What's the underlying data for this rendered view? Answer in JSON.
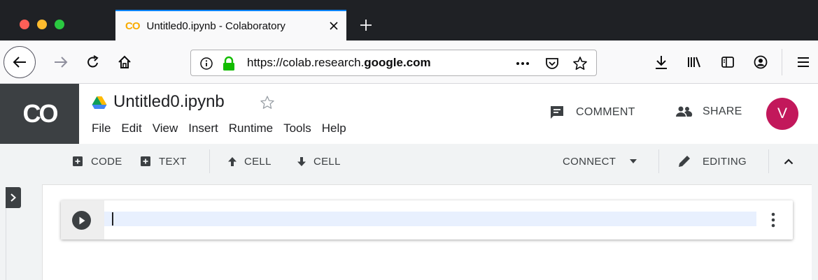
{
  "browser": {
    "tab": {
      "favicon_text": "CO",
      "title": "Untitled0.ipynb - Colaboratory",
      "close_glyph": "✕"
    },
    "new_tab_glyph": "+",
    "url": {
      "prefix": "https://colab.research.",
      "domain": "google.com"
    }
  },
  "colab": {
    "logo_text": "CO",
    "notebook_title": "Untitled0.ipynb",
    "menu": [
      "File",
      "Edit",
      "View",
      "Insert",
      "Runtime",
      "Tools",
      "Help"
    ],
    "comment_label": "COMMENT",
    "share_label": "SHARE",
    "avatar_initial": "V",
    "toolbar": {
      "add_code": "CODE",
      "add_text": "TEXT",
      "cell_up": "CELL",
      "cell_down": "CELL",
      "connect": "CONNECT",
      "editing": "EDITING"
    }
  },
  "colors": {
    "accent_tab": "#0a84ff",
    "colab_orange": "#f9ab00",
    "avatar": "#c2185b",
    "lock_green": "#12bc00"
  }
}
